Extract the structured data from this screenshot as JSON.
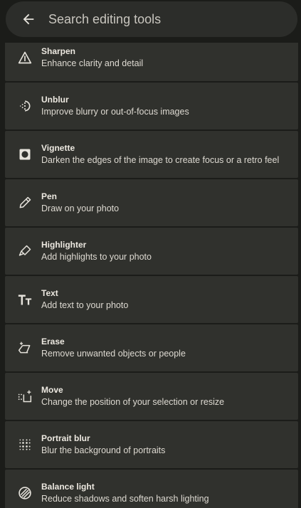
{
  "search": {
    "placeholder": "Search editing tools",
    "value": ""
  },
  "icons": {
    "back": "arrow-back-icon"
  },
  "tools": [
    {
      "name": "Sharpen",
      "desc": "Enhance clarity and detail",
      "icon": "sharpen-icon"
    },
    {
      "name": "Unblur",
      "desc": "Improve blurry or out-of-focus images",
      "icon": "unblur-icon"
    },
    {
      "name": "Vignette",
      "desc": "Darken the edges of the image to create focus or a retro feel",
      "icon": "vignette-icon"
    },
    {
      "name": "Pen",
      "desc": "Draw on your photo",
      "icon": "pen-icon"
    },
    {
      "name": "Highlighter",
      "desc": "Add highlights to your photo",
      "icon": "highlighter-icon"
    },
    {
      "name": "Text",
      "desc": "Add text to your photo",
      "icon": "text-icon"
    },
    {
      "name": "Erase",
      "desc": "Remove unwanted objects or people",
      "icon": "erase-icon"
    },
    {
      "name": "Move",
      "desc": "Change the position of your selection or resize",
      "icon": "move-icon"
    },
    {
      "name": "Portrait blur",
      "desc": "Blur the background of portraits",
      "icon": "portrait-blur-icon"
    },
    {
      "name": "Balance light",
      "desc": "Reduce shadows and soften harsh lighting",
      "icon": "balance-light-icon"
    }
  ],
  "colors": {
    "background": "#1b1c19",
    "surface": "#30312d",
    "search_bar": "#2c2d2a",
    "text": "#e6e3dc"
  }
}
